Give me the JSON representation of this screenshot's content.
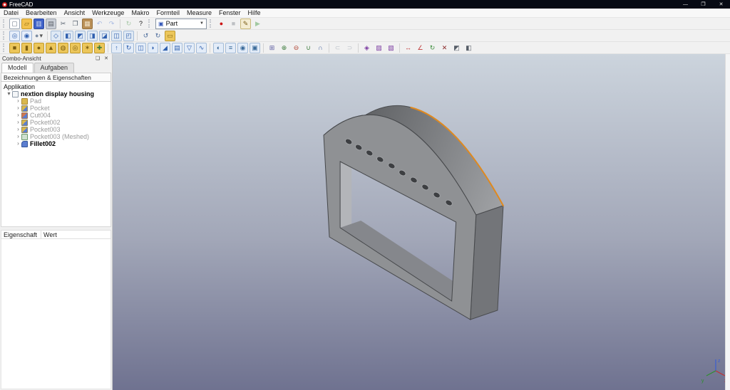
{
  "window": {
    "title": "FreeCAD",
    "controls": {
      "minimize": "—",
      "maximize": "❐",
      "close": "✕"
    }
  },
  "menu": {
    "items": [
      "Datei",
      "Bearbeiten",
      "Ansicht",
      "Werkzeuge",
      "Makro",
      "Formteil",
      "Measure",
      "Fenster",
      "Hilfe"
    ]
  },
  "workbench_selector": {
    "value": "Part",
    "cube_icon": "▣",
    "arrow": "▼"
  },
  "toolbars": {
    "file": [
      {
        "n": "document-new",
        "ch": "▢",
        "fg": "#6a7686",
        "bg": "#ffffff",
        "bd": "#9aa6b4"
      },
      {
        "n": "document-open",
        "ch": "▱",
        "fg": "#8a6a10",
        "bg": "#f2c14e",
        "bd": "#c89a28"
      },
      {
        "n": "document-save",
        "ch": "▥",
        "fg": "#cdd8f0",
        "bg": "#3f62c9",
        "bd": "#2c4a9e"
      },
      {
        "n": "document-print",
        "ch": "▤",
        "fg": "#5a6068",
        "bg": "#c9ced6",
        "bd": "#9aa0a8"
      },
      {
        "n": "edit-cut",
        "ch": "✂",
        "fg": "#55606e"
      },
      {
        "n": "edit-copy",
        "ch": "❐",
        "fg": "#55606e"
      },
      {
        "n": "edit-paste",
        "ch": "▦",
        "fg": "#f0e2c8",
        "bg": "#b98f56",
        "bd": "#96713e"
      },
      {
        "n": "edit-undo",
        "ch": "↶",
        "fg": "#3a66cc",
        "dim": true
      },
      {
        "n": "edit-redo",
        "ch": "↷",
        "fg": "#3a66cc",
        "dim": true
      },
      {
        "sep": true
      },
      {
        "n": "refresh",
        "ch": "↻",
        "fg": "#3e8e3e",
        "dim": true
      },
      {
        "n": "whats-this",
        "ch": "?",
        "fg": "#1a1a1a"
      }
    ],
    "macro": [
      {
        "n": "macro-record",
        "ch": "●",
        "fg": "#cc1414"
      },
      {
        "n": "macro-stop",
        "ch": "■",
        "fg": "#707880",
        "dim": true
      },
      {
        "n": "macro-edit",
        "ch": "✎",
        "fg": "#7a5c18",
        "bg": "#f4ecd2",
        "bd": "#c8b87a"
      },
      {
        "n": "macro-execute",
        "ch": "▶",
        "fg": "#2e8e2e",
        "dim": true
      }
    ],
    "view": [
      {
        "n": "fit-all",
        "ch": "◎",
        "fg": "#2f5fae",
        "bg": "#e6eefa",
        "bd": "#9ab2d4"
      },
      {
        "n": "fit-selection",
        "ch": "◉",
        "fg": "#2f5fae",
        "bg": "#e6eefa",
        "bd": "#9ab2d4"
      },
      {
        "n": "draw-style",
        "ch": "●",
        "fg": "#7d8da2",
        "caret": "▾"
      },
      {
        "sep": true
      },
      {
        "n": "view-isometric",
        "ch": "◇",
        "fg": "#2f5fae",
        "bg": "#dfe9f4",
        "bd": "#a4bcd8"
      },
      {
        "n": "view-front",
        "ch": "◧",
        "fg": "#2f5fae",
        "bg": "#dfe9f4",
        "bd": "#a4bcd8"
      },
      {
        "n": "view-top",
        "ch": "◩",
        "fg": "#2f5fae",
        "bg": "#dfe9f4",
        "bd": "#a4bcd8"
      },
      {
        "n": "view-right",
        "ch": "◨",
        "fg": "#2f5fae",
        "bg": "#dfe9f4",
        "bd": "#a4bcd8"
      },
      {
        "n": "view-rear",
        "ch": "◪",
        "fg": "#2f5fae",
        "bg": "#dfe9f4",
        "bd": "#a4bcd8"
      },
      {
        "n": "view-bottom",
        "ch": "◫",
        "fg": "#2f5fae",
        "bg": "#dfe9f4",
        "bd": "#a4bcd8"
      },
      {
        "n": "view-left",
        "ch": "◰",
        "fg": "#2f5fae",
        "bg": "#dfe9f4",
        "bd": "#a4bcd8"
      },
      {
        "sep": true
      },
      {
        "n": "rotate-left",
        "ch": "↺",
        "fg": "#4a6a9a"
      },
      {
        "n": "rotate-right",
        "ch": "↻",
        "fg": "#4a6a9a"
      },
      {
        "n": "measure-distance-view",
        "ch": "▭",
        "fg": "#8a6a10",
        "bg": "#ecc65a",
        "bd": "#c09a2e"
      }
    ],
    "part": [
      {
        "n": "part-box",
        "ch": "■",
        "fg": "#7a5c10",
        "bg": "#ecc65a",
        "bd": "#c09a2e"
      },
      {
        "n": "part-cylinder",
        "ch": "▮",
        "fg": "#7a5c10",
        "bg": "#ecc65a",
        "bd": "#c09a2e"
      },
      {
        "n": "part-sphere",
        "ch": "●",
        "fg": "#7a5c10",
        "bg": "#ecc65a",
        "bd": "#c09a2e"
      },
      {
        "n": "part-cone",
        "ch": "▲",
        "fg": "#7a5c10",
        "bg": "#ecc65a",
        "bd": "#c09a2e"
      },
      {
        "n": "part-torus",
        "ch": "◍",
        "fg": "#7a5c10",
        "bg": "#ecc65a",
        "bd": "#c09a2e"
      },
      {
        "n": "part-tube",
        "ch": "◎",
        "fg": "#7a5c10",
        "bg": "#ecc65a",
        "bd": "#c09a2e"
      },
      {
        "n": "part-primitives",
        "ch": "✶",
        "fg": "#7a5c10",
        "bg": "#ecc65a",
        "bd": "#c09a2e"
      },
      {
        "n": "part-shapebuilder",
        "ch": "✚",
        "fg": "#3a7a3a",
        "bg": "#ecc65a",
        "bd": "#c09a2e"
      },
      {
        "sep": true
      },
      {
        "n": "part-extrude",
        "ch": "↑",
        "fg": "#2f5fae",
        "bg": "#e3ecf8",
        "bd": "#a4bcd8"
      },
      {
        "n": "part-revolve",
        "ch": "↻",
        "fg": "#2f5fae",
        "bg": "#e3ecf8",
        "bd": "#a4bcd8"
      },
      {
        "n": "part-mirror",
        "ch": "◫",
        "fg": "#2f5fae",
        "bg": "#e3ecf8",
        "bd": "#a4bcd8"
      },
      {
        "n": "part-fillet",
        "ch": "◗",
        "fg": "#2f5fae",
        "bg": "#e3ecf8",
        "bd": "#a4bcd8"
      },
      {
        "n": "part-chamfer",
        "ch": "◢",
        "fg": "#2f5fae",
        "bg": "#e3ecf8",
        "bd": "#a4bcd8"
      },
      {
        "n": "part-ruled-surface",
        "ch": "▤",
        "fg": "#2f5fae",
        "bg": "#e3ecf8",
        "bd": "#a4bcd8"
      },
      {
        "n": "part-loft",
        "ch": "▽",
        "fg": "#2f5fae",
        "bg": "#e3ecf8",
        "bd": "#a4bcd8"
      },
      {
        "n": "part-sweep",
        "ch": "∿",
        "fg": "#2f5fae",
        "bg": "#e3ecf8",
        "bd": "#a4bcd8"
      },
      {
        "sep": true
      },
      {
        "n": "part-section",
        "ch": "◐",
        "fg": "#3a6a9a",
        "bg": "#e3ecf8",
        "bd": "#a4bcd8"
      },
      {
        "n": "part-cross-sections",
        "ch": "≡",
        "fg": "#3a6a9a",
        "bg": "#e3ecf8",
        "bd": "#a4bcd8"
      },
      {
        "n": "part-offset",
        "ch": "◉",
        "fg": "#3a6a9a",
        "bg": "#e3ecf8",
        "bd": "#a4bcd8"
      },
      {
        "n": "part-thickness",
        "ch": "▣",
        "fg": "#3a6a9a",
        "bg": "#e3ecf8",
        "bd": "#a4bcd8"
      },
      {
        "sep": true
      },
      {
        "n": "part-compound",
        "ch": "⊞",
        "fg": "#5a5aa0"
      },
      {
        "n": "part-boolean",
        "ch": "⊕",
        "fg": "#3a7a3a"
      },
      {
        "n": "part-cut",
        "ch": "⊖",
        "fg": "#b04432"
      },
      {
        "n": "part-union",
        "ch": "∪",
        "fg": "#3a7a3a"
      },
      {
        "n": "part-intersection",
        "ch": "∩",
        "fg": "#3a5a9a"
      },
      {
        "sep": true
      },
      {
        "n": "part-join-connect",
        "ch": "⊂",
        "fg": "#708090",
        "dim": true
      },
      {
        "n": "part-join-embed",
        "ch": "⊃",
        "fg": "#708090",
        "dim": true
      },
      {
        "sep": true
      },
      {
        "n": "part-boolean-fragments",
        "ch": "◈",
        "fg": "#7a3aa0"
      },
      {
        "n": "part-slice-apart",
        "ch": "▨",
        "fg": "#7a3aa0"
      },
      {
        "n": "part-slice",
        "ch": "▧",
        "fg": "#7a3aa0"
      },
      {
        "sep": true
      },
      {
        "n": "measure-linear",
        "ch": "↔",
        "fg": "#c03a3a"
      },
      {
        "n": "measure-angular",
        "ch": "∠",
        "fg": "#c03a3a"
      },
      {
        "n": "measure-refresh",
        "ch": "↻",
        "fg": "#3e8e3e"
      },
      {
        "n": "measure-clear-all",
        "ch": "✕",
        "fg": "#8a2a2a"
      },
      {
        "n": "measure-toggle-all",
        "ch": "◩",
        "fg": "#555c66"
      },
      {
        "n": "measure-toggle-3d",
        "ch": "◧",
        "fg": "#555c66"
      }
    ]
  },
  "combo": {
    "title": "Combo-Ansicht",
    "float_icon": "❏",
    "close_icon": "✕",
    "tabs": [
      {
        "label": "Modell"
      },
      {
        "label": "Aufgaben"
      }
    ],
    "section": "Bezeichnungen & Eigenschaften",
    "tree": [
      {
        "label": "Applikation",
        "text_style": "color:#111"
      },
      {
        "label": "nextion display housing",
        "chevron": "▾",
        "icon_style": "background:#f4f6f8;border:1px solid #8e9aa8",
        "text_style": "font-weight:bold;color:#000"
      },
      {
        "label": "Pad",
        "chevron": "›",
        "icon_style": "background:#d9b84e;border:1px solid #a8862e",
        "text_style": "color:#9a9a9a"
      },
      {
        "label": "Pocket",
        "chevron": "›",
        "icon_style": "background:linear-gradient(135deg,#d9b84e 50%,#5b7ed0 50%);border:1px solid #90885a",
        "text_style": "color:#9a9a9a"
      },
      {
        "label": "Cut004",
        "chevron": "›",
        "icon_style": "background:linear-gradient(135deg,#cf7a52 50%,#5b7ed0 50%);border:1px solid #9a7055",
        "text_style": "color:#9a9a9a"
      },
      {
        "label": "Pocket002",
        "chevron": "›",
        "icon_style": "background:linear-gradient(135deg,#d9b84e 50%,#5b7ed0 50%);border:1px solid #90885a",
        "text_style": "color:#9a9a9a"
      },
      {
        "label": "Pocket003",
        "chevron": "›",
        "icon_style": "background:linear-gradient(135deg,#d9b84e 50%,#5b7ed0 50%);border:1px solid #90885a",
        "text_style": "color:#9a9a9a"
      },
      {
        "label": "Pocket003 (Meshed)",
        "chevron": "›",
        "icon_style": "background:#cfe0cf;border:1px solid #6a9a6a",
        "text_style": "color:#9a9a9a"
      },
      {
        "label": "Fillet002",
        "chevron": "›",
        "icon_style": "background:#5b7ed0;border:1px solid #33559a;border-radius:4px 1px 1px 1px",
        "text_style": "font-weight:bold;color:#000"
      }
    ],
    "properties": {
      "col1": "Eigenschaft",
      "col2": "Wert"
    }
  },
  "viewport": {
    "bg_style": "background:linear-gradient(180deg,#ccd4dd 0%,#a2a7b8 55%,#6f7290 100%)",
    "selection_color": "#e0891e",
    "model_front_color": "#8f9194",
    "model_side_color": "#737579",
    "axis": {
      "x": "x",
      "y": "y",
      "z": "z"
    }
  }
}
